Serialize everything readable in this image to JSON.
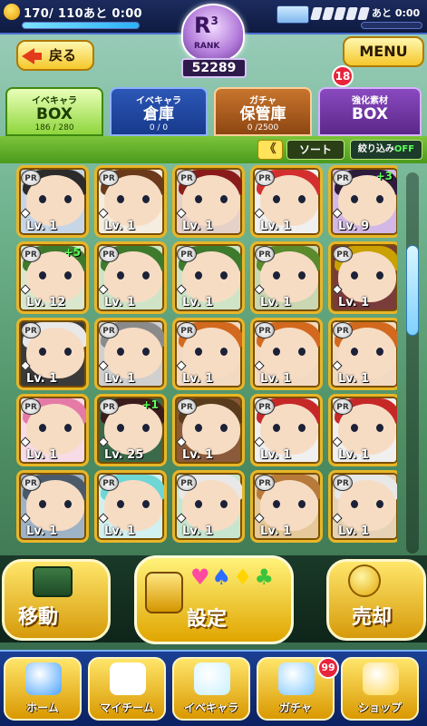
{
  "status": {
    "stamina_text": "170/ 110あと 0:00",
    "stamina_fill_fraction": 1.0,
    "ticket_time": "あと 0:00"
  },
  "rank": {
    "letter": "R",
    "superscript": "3",
    "sub": "RANK",
    "score": "52289"
  },
  "header": {
    "back_label": "戻る",
    "menu_label": "MENU",
    "menu_badge": "18"
  },
  "tabs": [
    {
      "top": "イベキャラ",
      "main": "BOX",
      "count": "186 / 280"
    },
    {
      "top": "イベキャラ",
      "main": "倉庫",
      "count": "0 / 0"
    },
    {
      "top": "ガチャ",
      "main": "保管庫",
      "count": "0 /2500"
    },
    {
      "top": "強化素材",
      "main": "BOX",
      "count": ""
    }
  ],
  "sortbar": {
    "arrows": "《",
    "sort_label": "ソート",
    "filter_label": "絞り込み",
    "filter_state": "OFF"
  },
  "cards": [
    {
      "level": "Lv. 1",
      "plus": "",
      "hair": "#2b2b2b",
      "bg": "#c7d6e6"
    },
    {
      "level": "Lv. 1",
      "plus": "",
      "hair": "#6b3a1b",
      "bg": "#f5ede0"
    },
    {
      "level": "Lv. 1",
      "plus": "",
      "hair": "#8a1b1b",
      "bg": "#e6d1c9"
    },
    {
      "level": "Lv. 1",
      "plus": "",
      "hair": "#d32f2f",
      "bg": "#f0f0f0"
    },
    {
      "level": "Lv. 9",
      "plus": "+3",
      "hair": "#2c1b3b",
      "bg": "#d3b7e6"
    },
    {
      "level": "Lv. 12",
      "plus": "+5",
      "hair": "#3e7a2c",
      "bg": "#d9e7cf"
    },
    {
      "level": "Lv. 1",
      "plus": "",
      "hair": "#3e7a2c",
      "bg": "#cfe4c7"
    },
    {
      "level": "Lv. 1",
      "plus": "",
      "hair": "#3e7a2c",
      "bg": "#cfe4c7"
    },
    {
      "level": "Lv. 1",
      "plus": "",
      "hair": "#5b8a2c",
      "bg": "#c9d7b3"
    },
    {
      "level": "Lv. 1",
      "plus": "",
      "hair": "#c9a100",
      "bg": "#7a3b3b"
    },
    {
      "level": "Lv. 1",
      "plus": "",
      "hair": "#e8e8e8",
      "bg": "#3a3a3a"
    },
    {
      "level": "Lv. 1",
      "plus": "",
      "hair": "#8a8a8a",
      "bg": "#d0d0d0"
    },
    {
      "level": "Lv. 1",
      "plus": "",
      "hair": "#d2691e",
      "bg": "#f2d9c2"
    },
    {
      "level": "Lv. 1",
      "plus": "",
      "hair": "#d2691e",
      "bg": "#f2d9c2"
    },
    {
      "level": "Lv. 1",
      "plus": "",
      "hair": "#d2691e",
      "bg": "#f2d9c2"
    },
    {
      "level": "Lv. 1",
      "plus": "",
      "hair": "#e57aa7",
      "bg": "#f7dce7"
    },
    {
      "level": "Lv. 25",
      "plus": "+1",
      "hair": "#3b1b1b",
      "bg": "#3a6a4a"
    },
    {
      "level": "Lv. 1",
      "plus": "",
      "hair": "#5a3b1b",
      "bg": "#8a5a3b"
    },
    {
      "level": "Lv. 1",
      "plus": "",
      "hair": "#c62828",
      "bg": "#f0f0f0"
    },
    {
      "level": "Lv. 1",
      "plus": "",
      "hair": "#c62828",
      "bg": "#f0f0f0"
    },
    {
      "level": "Lv. 1",
      "plus": "",
      "hair": "#4a5a6a",
      "bg": "#9fb3c7"
    },
    {
      "level": "Lv. 1",
      "plus": "",
      "hair": "#6fd6d6",
      "bg": "#d3f0f0"
    },
    {
      "level": "Lv. 1",
      "plus": "",
      "hair": "#e8e8e8",
      "bg": "#c7e6d0"
    },
    {
      "level": "Lv. 1",
      "plus": "",
      "hair": "#b87a3b",
      "bg": "#e6c99a"
    },
    {
      "level": "Lv. 1",
      "plus": "",
      "hair": "#e8e8e8",
      "bg": "#e6d3b7"
    }
  ],
  "actions": {
    "move_label": "移動",
    "set_label": "設定",
    "sell_label": "売却"
  },
  "nav": [
    {
      "label": "ホーム",
      "icon": "home-icon",
      "color": "#4aa3ff"
    },
    {
      "label": "マイチーム",
      "icon": "team-icon",
      "color": "#ffffff"
    },
    {
      "label": "イベキャラ",
      "icon": "event-chara-icon",
      "color": "#c9f0ff"
    },
    {
      "label": "ガチャ",
      "icon": "gacha-icon",
      "color": "#7ec8ff"
    },
    {
      "label": "ショップ",
      "icon": "shop-icon",
      "color": "#ffd54a"
    }
  ],
  "nav_badge": "99"
}
